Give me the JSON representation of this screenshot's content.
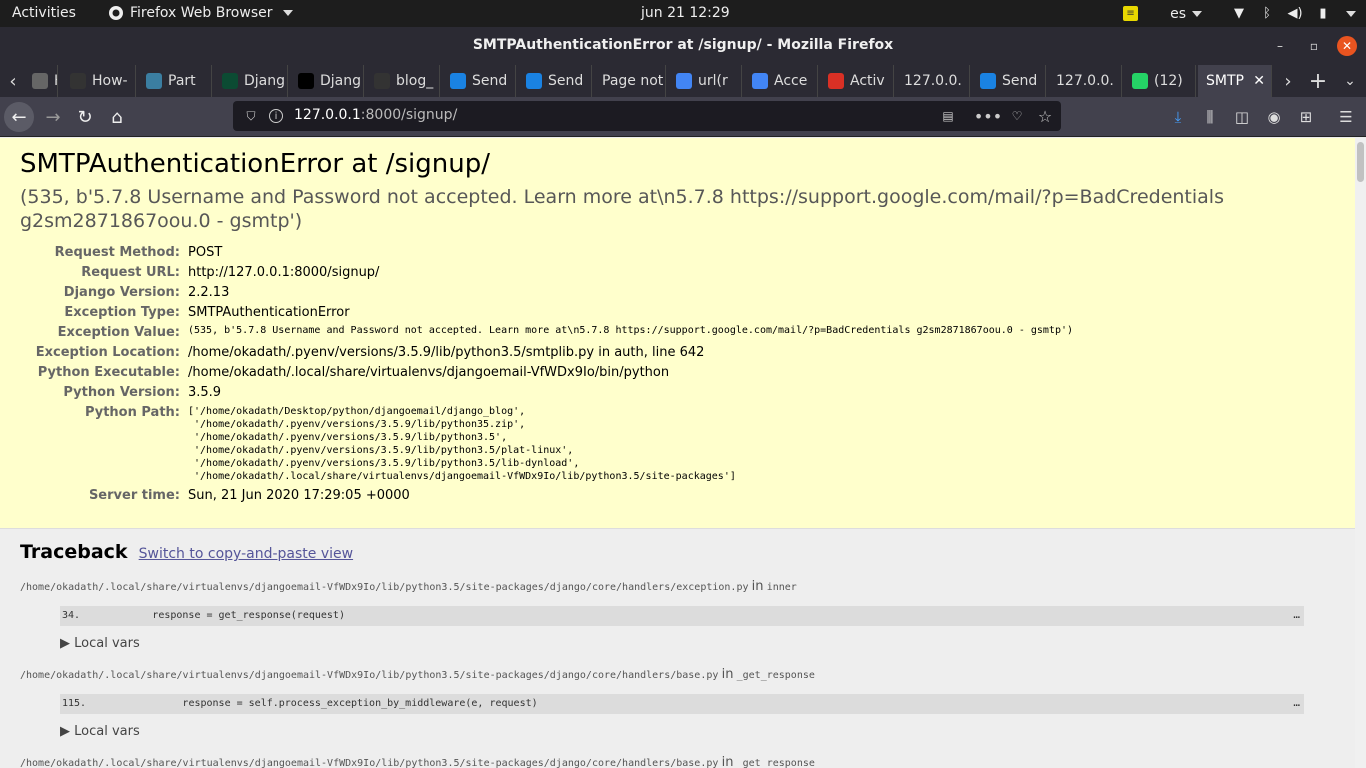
{
  "topbar": {
    "activities": "Activities",
    "app_menu": "Firefox Web Browser",
    "clock": "jun 21  12:29",
    "keyboard_layout": "es"
  },
  "window": {
    "title": "SMTPAuthenticationError at /signup/ - Mozilla Firefox"
  },
  "tabs": [
    {
      "label": "How",
      "icon": "generic-page-icon",
      "color": "#666666"
    },
    {
      "label": "How-",
      "icon": "github-icon",
      "color": "#333333"
    },
    {
      "label": "Part",
      "icon": "globe-icon",
      "color": "#3b7ea1"
    },
    {
      "label": "Djang",
      "icon": "django-icon",
      "color": "#0c4b33"
    },
    {
      "label": "Djang",
      "icon": "medium-icon",
      "color": "#000000"
    },
    {
      "label": "blog_",
      "icon": "github-icon",
      "color": "#333333"
    },
    {
      "label": "Send",
      "icon": "sendgrid-icon",
      "color": "#1a82e2"
    },
    {
      "label": "Send",
      "icon": "sendgrid-icon",
      "color": "#1a82e2"
    },
    {
      "label": "Page not",
      "icon": "",
      "color": ""
    },
    {
      "label": "url(r",
      "icon": "google-icon",
      "color": "#4285f4"
    },
    {
      "label": "Acce",
      "icon": "google-icon",
      "color": "#4285f4"
    },
    {
      "label": "Activ",
      "icon": "gmail-icon",
      "color": "#d93025"
    },
    {
      "label": "127.0.0.",
      "icon": "",
      "color": ""
    },
    {
      "label": "Send",
      "icon": "sendgrid-icon",
      "color": "#1a82e2"
    },
    {
      "label": "127.0.0.",
      "icon": "",
      "color": ""
    },
    {
      "label": "(12)",
      "icon": "whatsapp-icon",
      "color": "#25d366"
    },
    {
      "label": "SMTP",
      "icon": "",
      "color": "",
      "active": true
    }
  ],
  "urlbar": {
    "host": "127.0.0.1",
    "rest": ":8000/signup/"
  },
  "error": {
    "title": "SMTPAuthenticationError at /signup/",
    "message": "(535, b'5.7.8 Username and Password not accepted. Learn more at\\n5.7.8  https://support.google.com/mail/?p=BadCredentials g2sm2871867oou.0 - gsmtp')",
    "meta": [
      {
        "label": "Request Method:",
        "value": "POST",
        "mono": false
      },
      {
        "label": "Request URL:",
        "value": "http://127.0.0.1:8000/signup/",
        "mono": false
      },
      {
        "label": "Django Version:",
        "value": "2.2.13",
        "mono": false
      },
      {
        "label": "Exception Type:",
        "value": "SMTPAuthenticationError",
        "mono": false
      },
      {
        "label": "Exception Value:",
        "value": "(535, b'5.7.8 Username and Password not accepted. Learn more at\\n5.7.8  https://support.google.com/mail/?p=BadCredentials g2sm2871867oou.0 - gsmtp')",
        "mono": true
      },
      {
        "label": "Exception Location:",
        "value": "/home/okadath/.pyenv/versions/3.5.9/lib/python3.5/smtplib.py in auth, line 642",
        "mono": false
      },
      {
        "label": "Python Executable:",
        "value": "/home/okadath/.local/share/virtualenvs/djangoemail-VfWDx9Io/bin/python",
        "mono": false
      },
      {
        "label": "Python Version:",
        "value": "3.5.9",
        "mono": false
      },
      {
        "label": "Python Path:",
        "value": "['/home/okadath/Desktop/python/djangoemail/django_blog',\n '/home/okadath/.pyenv/versions/3.5.9/lib/python35.zip',\n '/home/okadath/.pyenv/versions/3.5.9/lib/python3.5',\n '/home/okadath/.pyenv/versions/3.5.9/lib/python3.5/plat-linux',\n '/home/okadath/.pyenv/versions/3.5.9/lib/python3.5/lib-dynload',\n '/home/okadath/.local/share/virtualenvs/djangoemail-VfWDx9Io/lib/python3.5/site-packages']",
        "mono": true,
        "pre": true
      },
      {
        "label": "Server time:",
        "value": "Sun, 21 Jun 2020 17:29:05 +0000",
        "mono": false
      }
    ]
  },
  "traceback": {
    "heading": "Traceback",
    "switch_link": "Switch to copy-and-paste view",
    "in_word": "in",
    "frames": [
      {
        "file": "/home/okadath/.local/share/virtualenvs/djangoemail-VfWDx9Io/lib/python3.5/site-packages/django/core/handlers/exception.py",
        "func": "inner",
        "line_no": "34.",
        "code": "            response = get_response(request)",
        "local_vars": "▶ Local vars"
      },
      {
        "file": "/home/okadath/.local/share/virtualenvs/djangoemail-VfWDx9Io/lib/python3.5/site-packages/django/core/handlers/base.py",
        "func": "_get_response",
        "line_no": "115.",
        "code": "                response = self.process_exception_by_middleware(e, request)",
        "local_vars": "▶ Local vars"
      },
      {
        "file": "/home/okadath/.local/share/virtualenvs/djangoemail-VfWDx9Io/lib/python3.5/site-packages/django/core/handlers/base.py",
        "func": "_get_response",
        "line_no": "",
        "code": "",
        "local_vars": ""
      }
    ],
    "ellipsis": "…"
  }
}
